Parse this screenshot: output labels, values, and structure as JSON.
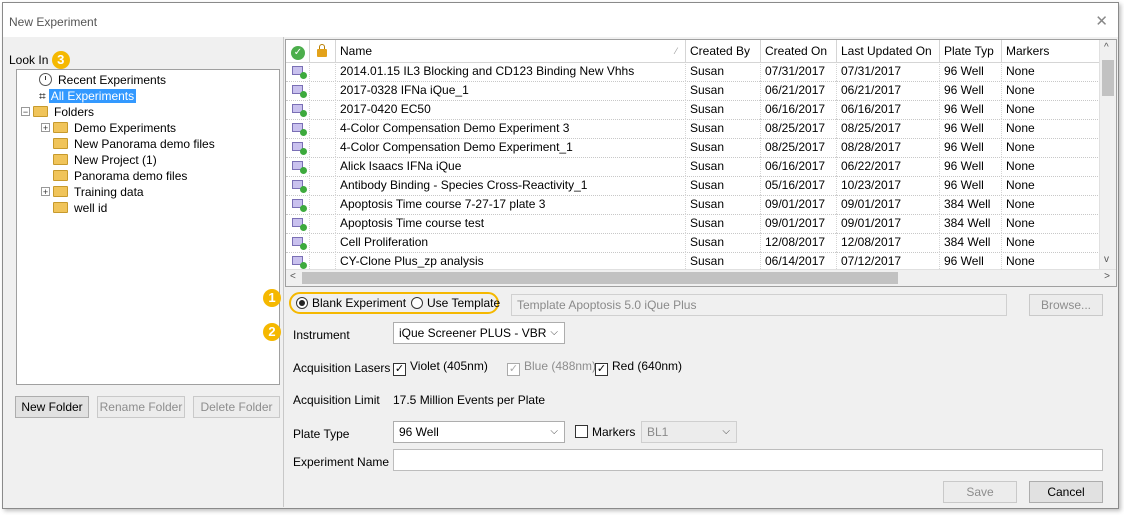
{
  "window": {
    "title": "New Experiment",
    "close_glyph": "✕"
  },
  "left": {
    "look_in_label": "Look In",
    "look_in_badge": "3",
    "tree": {
      "recent": "Recent Experiments",
      "all": "All Experiments",
      "folders": "Folders",
      "children": [
        "Demo Experiments",
        "New Panorama demo files",
        "New Project (1)",
        "Panorama demo files",
        "Training data",
        "well id"
      ]
    },
    "buttons": {
      "new_folder": "New Folder",
      "rename_folder": "Rename Folder",
      "delete_folder": "Delete Folder"
    }
  },
  "grid": {
    "headers": {
      "name": "Name",
      "created_by": "Created By",
      "created_on": "Created On",
      "last_updated_on": "Last Updated On",
      "plate_type": "Plate Typ",
      "markers": "Markers"
    },
    "rows": [
      {
        "name": "2014.01.15 IL3 Blocking and CD123 Binding New Vhhs",
        "created_by": "Susan",
        "created_on": "07/31/2017",
        "last_updated_on": "07/31/2017",
        "plate_type": "96 Well",
        "markers": "None"
      },
      {
        "name": "2017-0328 IFNa iQue_1",
        "created_by": "Susan",
        "created_on": "06/21/2017",
        "last_updated_on": "06/21/2017",
        "plate_type": "96 Well",
        "markers": "None"
      },
      {
        "name": "2017-0420 EC50",
        "created_by": "Susan",
        "created_on": "06/16/2017",
        "last_updated_on": "06/16/2017",
        "plate_type": "96 Well",
        "markers": "None"
      },
      {
        "name": "4-Color Compensation Demo Experiment 3",
        "created_by": "Susan",
        "created_on": "08/25/2017",
        "last_updated_on": "08/25/2017",
        "plate_type": "96 Well",
        "markers": "None"
      },
      {
        "name": "4-Color Compensation Demo Experiment_1",
        "created_by": "Susan",
        "created_on": "08/25/2017",
        "last_updated_on": "08/28/2017",
        "plate_type": "96 Well",
        "markers": "None"
      },
      {
        "name": "Alick Isaacs IFNa iQue",
        "created_by": "Susan",
        "created_on": "06/16/2017",
        "last_updated_on": "06/22/2017",
        "plate_type": "96 Well",
        "markers": "None"
      },
      {
        "name": "Antibody Binding - Species Cross-Reactivity_1",
        "created_by": "Susan",
        "created_on": "05/16/2017",
        "last_updated_on": "10/23/2017",
        "plate_type": "96 Well",
        "markers": "None"
      },
      {
        "name": "Apoptosis Time course 7-27-17 plate 3",
        "created_by": "Susan",
        "created_on": "09/01/2017",
        "last_updated_on": "09/01/2017",
        "plate_type": "384 Well",
        "markers": "None"
      },
      {
        "name": "Apoptosis Time course test",
        "created_by": "Susan",
        "created_on": "09/01/2017",
        "last_updated_on": "09/01/2017",
        "plate_type": "384 Well",
        "markers": "None"
      },
      {
        "name": "Cell Proliferation",
        "created_by": "Susan",
        "created_on": "12/08/2017",
        "last_updated_on": "12/08/2017",
        "plate_type": "384 Well",
        "markers": "None"
      },
      {
        "name": "CY-Clone Plus_zp analysis",
        "created_by": "Susan",
        "created_on": "06/14/2017",
        "last_updated_on": "07/12/2017",
        "plate_type": "96 Well",
        "markers": "None"
      }
    ]
  },
  "form": {
    "badge1": "1",
    "badge2": "2",
    "blank_experiment": "Blank Experiment",
    "use_template": "Use Template",
    "template_value": "Template Apoptosis 5.0 iQue Plus",
    "browse": "Browse...",
    "instrument_label": "Instrument",
    "instrument_value": "iQue Screener PLUS - VBR",
    "lasers_label": "Acquisition Lasers",
    "laser_violet": "Violet (405nm)",
    "laser_blue": "Blue (488nm)",
    "laser_red": "Red (640nm)",
    "limit_label": "Acquisition Limit",
    "limit_value": "17.5 Million Events per Plate",
    "plate_type_label": "Plate Type",
    "plate_type_value": "96 Well",
    "markers_label": "Markers",
    "markers_value": "BL1",
    "experiment_name_label": "Experiment Name",
    "experiment_name_value": "",
    "save": "Save",
    "cancel": "Cancel"
  },
  "colors": {
    "badge": "#f5b800",
    "selection": "#3399ff",
    "ok_green": "#4cae4c"
  }
}
